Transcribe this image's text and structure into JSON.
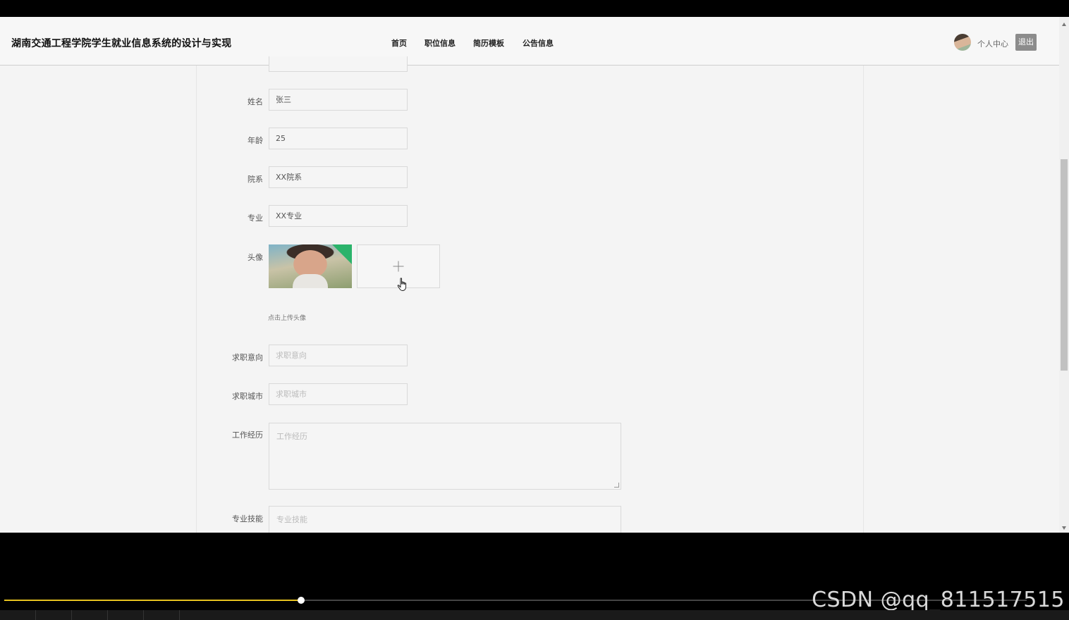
{
  "header": {
    "title": "湖南交通工程学院学生就业信息系统的设计与实现",
    "nav": [
      {
        "label": "首页"
      },
      {
        "label": "职位信息"
      },
      {
        "label": "简历模板"
      },
      {
        "label": "公告信息"
      }
    ],
    "user_center_label": "个人中心",
    "logout_label": "退出"
  },
  "form": {
    "name": {
      "label": "姓名",
      "value": "张三"
    },
    "age": {
      "label": "年龄",
      "value": "25"
    },
    "department": {
      "label": "院系",
      "value": "XX院系"
    },
    "major": {
      "label": "专业",
      "value": "XX专业"
    },
    "avatar": {
      "label": "头像",
      "hint": "点击上传头像"
    },
    "job_intention": {
      "label": "求职意向",
      "placeholder": "求职意向"
    },
    "job_city": {
      "label": "求职城市",
      "placeholder": "求职城市"
    },
    "work_experience": {
      "label": "工作经历",
      "placeholder": "工作经历"
    },
    "skills": {
      "label": "专业技能",
      "placeholder": "专业技能"
    }
  },
  "video_player": {
    "progress_fraction": 0.29,
    "accent_color": "#e6c21f"
  },
  "watermark": "CSDN @qq_811517515",
  "icons": {
    "upload": "plus-icon",
    "cursor": "hand-cursor-icon"
  }
}
